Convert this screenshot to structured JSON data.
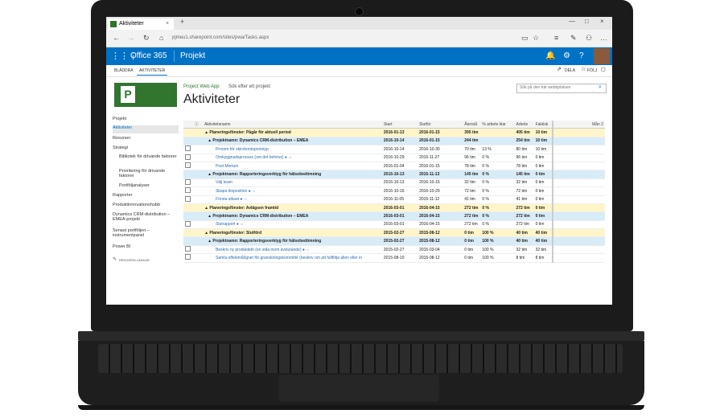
{
  "browser": {
    "tab_title": "Aktiviteter",
    "url": "pjmeu1.sharepoint.com/sites/pwa/Tasks.aspx",
    "back": "←",
    "forward": "→",
    "reload": "↻",
    "new_tab": "+"
  },
  "suite": {
    "app_name": "Office 365",
    "product": "Projekt"
  },
  "ribbon": {
    "tab1": "BLÄDDRA",
    "tab2": "AKTIVITETER",
    "share": "DELA",
    "follow": "FÖLJ"
  },
  "header": {
    "breadcrumb": "Project Web App",
    "search_project": "Sök efter ett projekt",
    "search_placeholder": "Sök på den här webbplatsen",
    "title": "Aktiviteter"
  },
  "nav": {
    "items": [
      "Projekt",
      "Aktiviteter",
      "Resurser",
      "Strategi",
      "Bibliotek för drivande faktorer",
      "Prioritering för drivande faktorer",
      "Portföljanalyser",
      "Rapporter",
      "Produktinnovationshubb",
      "Dynamics CRM-distribution – EMEA-projekt",
      "Senast portföljen – instrumentpanel",
      "Power BI"
    ],
    "edit_links": "REDIGERA LÄNKAR"
  },
  "table": {
    "headers": [
      "Aktivitetsnamn",
      "Start",
      "Slutför",
      "Återstå",
      "% arbete klar",
      "Arbete",
      "Faktisk",
      "Mån 2"
    ],
    "rows": [
      {
        "kind": "y",
        "cb": false,
        "name": "▲ Planeringsfönster: Pågår för aktuell period",
        "start": "2016-01-13",
        "finish": "2016-01-15",
        "rem": "395 tim",
        "pct": "",
        "work": "405 tim",
        "act": "10 tim"
      },
      {
        "kind": "b",
        "cb": false,
        "name": "▲ Projektnamn: Dynamics CRM-distribution – EMEA",
        "start": "2016-10-14",
        "finish": "2016-01-15",
        "rem": "244 tim",
        "pct": "",
        "work": "254 tim",
        "act": "10 tim"
      },
      {
        "kind": "l",
        "cb": true,
        "name": "Prorem för skirvbordsprototyp",
        "start": "2016-10-14",
        "finish": "2016-10-30",
        "rem": "70 tim",
        "pct": "13 %",
        "work": "80 tim",
        "act": "10 tim"
      },
      {
        "kind": "l",
        "cb": true,
        "name": "Omkyggnadsprocess (om det behövs) ● ⇔",
        "start": "2016-10-29",
        "finish": "2015-11-27",
        "rem": "96 tim",
        "pct": "0 %",
        "work": "96 tim",
        "act": "0 tim"
      },
      {
        "kind": "l",
        "cb": true,
        "name": "Post Mortum",
        "start": "2016-01-04",
        "finish": "2016-01-15",
        "rem": "78 tim",
        "pct": "0 %",
        "work": "78 tim",
        "act": "0 tim"
      },
      {
        "kind": "b",
        "cb": false,
        "name": "▲ Projektnamn: Rapporteringsverktyg för hälsobedömning",
        "start": "2015-10-13",
        "finish": "2015-11-13",
        "rem": "145 tim",
        "pct": "0 %",
        "work": "145 tim",
        "act": "0 tim"
      },
      {
        "kind": "l",
        "cb": true,
        "name": "Välj team",
        "start": "2016-10-13",
        "finish": "2016-10-16",
        "rem": "32 tim",
        "pct": "0 %",
        "work": "32 tim",
        "act": "0 tim"
      },
      {
        "kind": "l",
        "cb": true,
        "name": "Skapa disposition ● ⇔",
        "start": "2016-10-16",
        "finish": "2016-10-29",
        "rem": "72 tim",
        "pct": "0 %",
        "work": "72 tim",
        "act": "0 tim"
      },
      {
        "kind": "l",
        "cb": true,
        "name": "Första utkast ● ⇔",
        "start": "2016-11-05",
        "finish": "2015-11-12",
        "rem": "41 tim",
        "pct": "0 %",
        "work": "41 tim",
        "act": "0 tim"
      },
      {
        "kind": "y",
        "cb": false,
        "name": "▲ Planeringsfönster: Avlägsen framtid",
        "start": "2016-03-01",
        "finish": "2016-04-15",
        "rem": "272 tim",
        "pct": "0 %",
        "work": "272 tim",
        "act": "0 tim"
      },
      {
        "kind": "b",
        "cb": false,
        "name": "▲ Projektnamn: Dynamics CRM-distribution – EMEA",
        "start": "2016-03-01",
        "finish": "2016-04-15",
        "rem": "272 tim",
        "pct": "0 %",
        "work": "272 tim",
        "act": "0 tim"
      },
      {
        "kind": "l",
        "cb": true,
        "name": "Slutrapport ● ⇔",
        "start": "2016-03-01",
        "finish": "2016-04-15",
        "rem": "272 tim",
        "pct": "0 %",
        "work": "272 tim",
        "act": "0 tim"
      },
      {
        "kind": "y",
        "cb": false,
        "name": "▲ Planeringsfönster: Slutförd",
        "start": "2015-02-27",
        "finish": "2015-08-12",
        "rem": "0 tim",
        "pct": "100 %",
        "work": "40 tim",
        "act": "40 tim"
      },
      {
        "kind": "b",
        "cb": false,
        "name": "▲ Projektnamn: Rapporteringsverktyg för hälsobedömning",
        "start": "2015-02-27",
        "finish": "2015-08-12",
        "rem": "0 tim",
        "pct": "100 %",
        "work": "40 tim",
        "act": "40 tim"
      },
      {
        "kind": "l",
        "cb": true,
        "name": "Beskriv ny produktidé (en sida inom avslutande) ● ⇔",
        "start": "2015-02-27",
        "finish": "2015-03-04",
        "rem": "0 tim",
        "pct": "100 %",
        "work": "32 tim",
        "act": "32 tim"
      },
      {
        "kind": "l",
        "cb": true,
        "name": "Samla effektmål/gnet för granskningskommitté (beskriv om att fullfölja allen eller in",
        "start": "2015-08-10",
        "finish": "2015-08-12",
        "rem": "0 tim",
        "pct": "100 %",
        "work": "8 tim",
        "act": "8 tim"
      }
    ]
  },
  "colors": {
    "suite_blue": "#0072c6",
    "project_green": "#31752f",
    "summary_yellow": "#fff5c8",
    "project_blue": "#d8ecf8"
  }
}
